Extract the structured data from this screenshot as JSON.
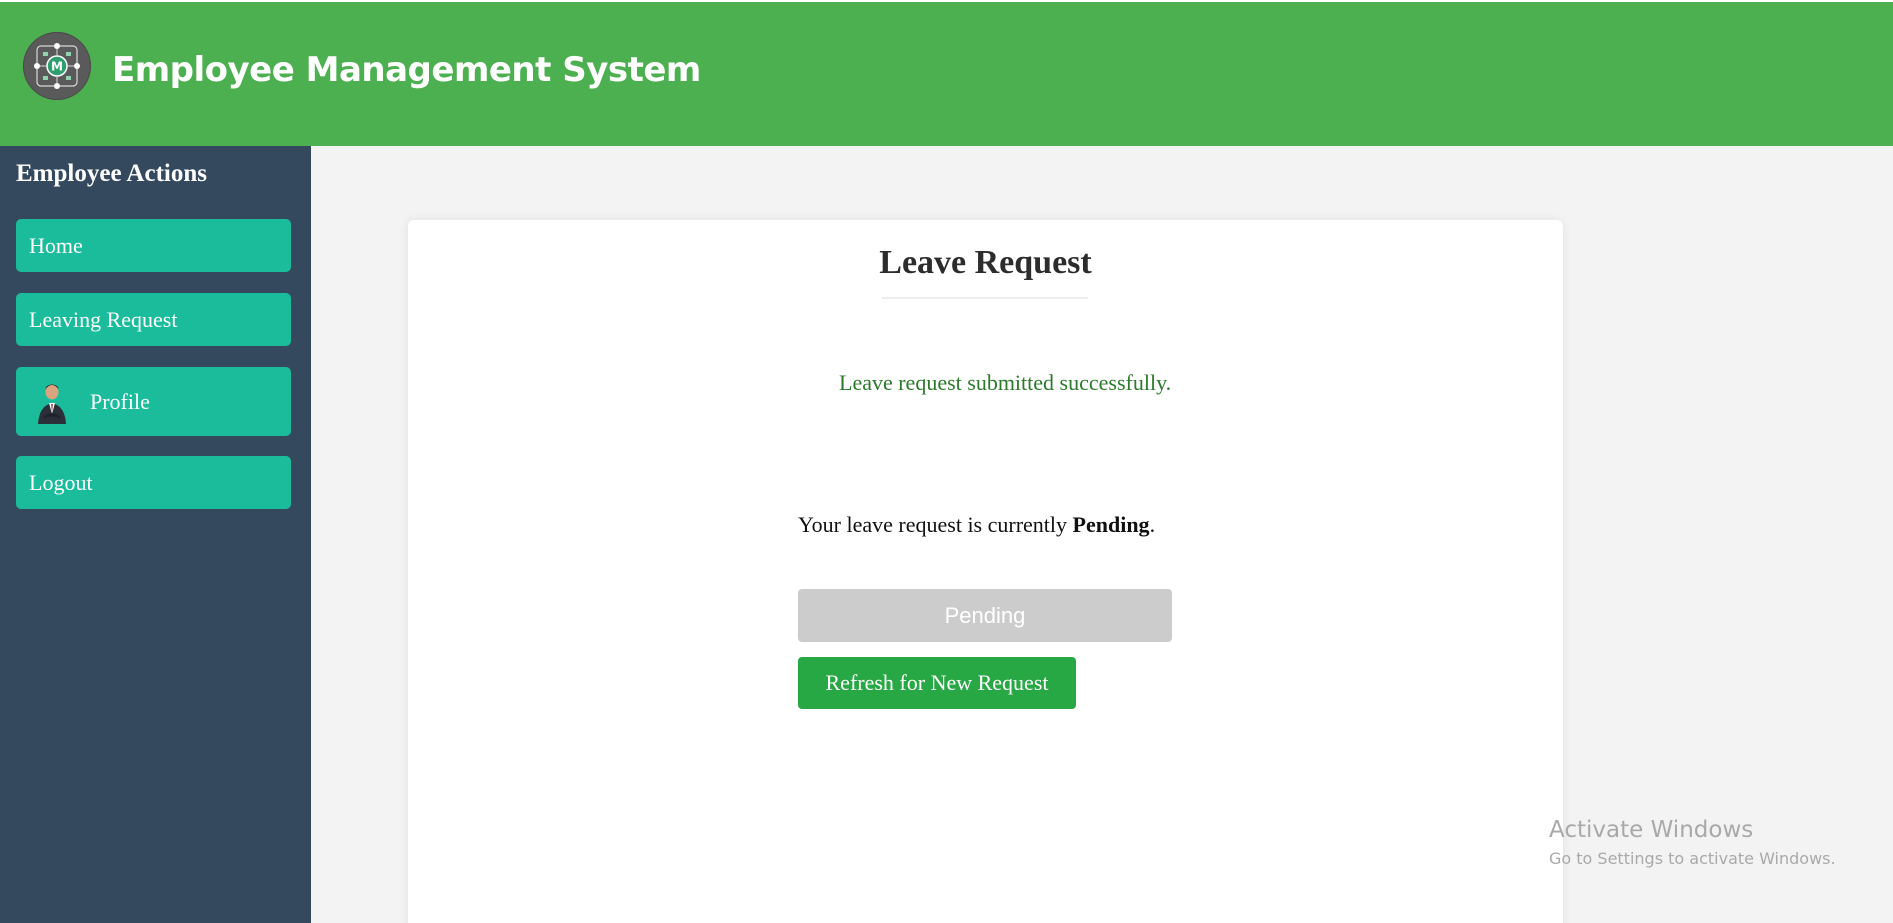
{
  "header": {
    "title": "Employee Management System",
    "logo_icon": "company-logo-icon",
    "logo_letter": "M"
  },
  "sidebar": {
    "title": "Employee Actions",
    "items": [
      {
        "label": "Home"
      },
      {
        "label": "Leaving Request"
      },
      {
        "label": "Profile",
        "icon": "avatar"
      },
      {
        "label": "Logout"
      }
    ]
  },
  "main": {
    "title": "Leave Request",
    "success_message": "Leave request submitted successfully.",
    "status_prefix": "Your leave request is currently",
    "status_value": "Pending",
    "status_suffix": ".",
    "pending_button": "Pending",
    "refresh_button": "Refresh for New Request"
  },
  "watermark": {
    "title": "Activate Windows",
    "subtitle": "Go to Settings to activate Windows."
  },
  "colors": {
    "header": "#4caf50",
    "sidebar": "#34495e",
    "nav_item": "#1abc9c",
    "success_text": "#2b7a2b",
    "refresh_button": "#28a745",
    "pending_button": "#cccccc"
  }
}
